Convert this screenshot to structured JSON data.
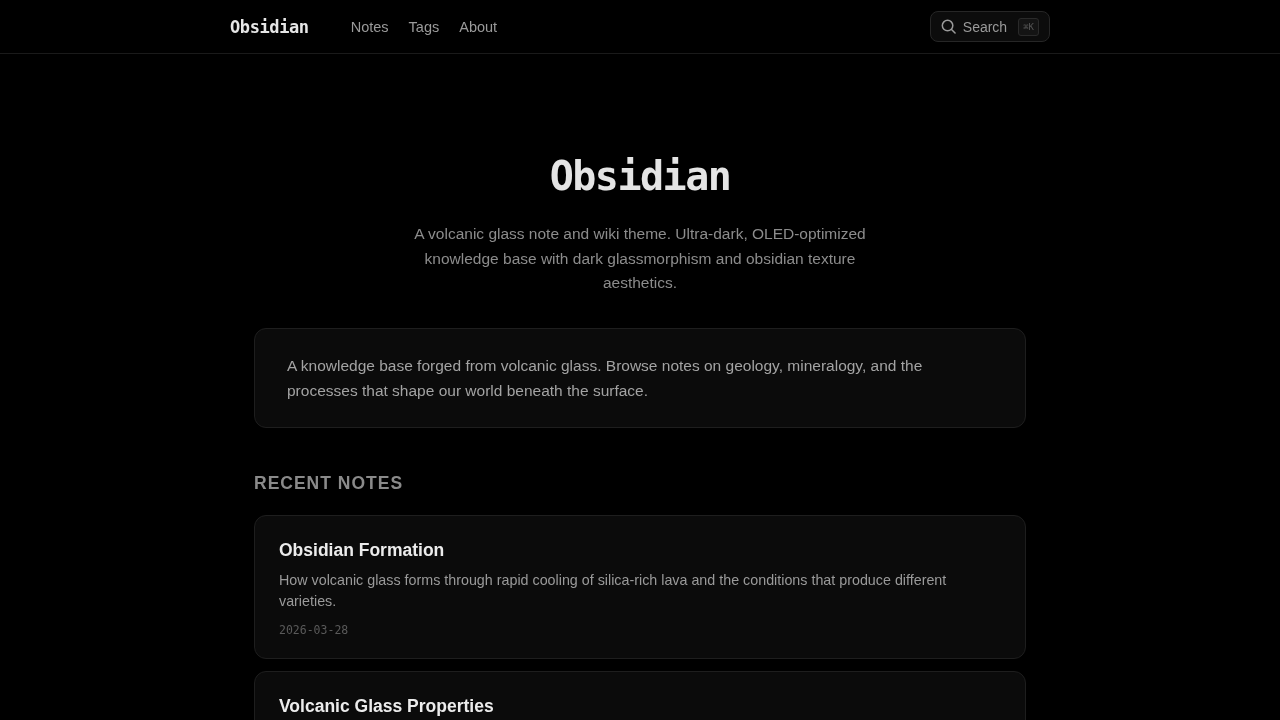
{
  "header": {
    "brand": "Obsidian",
    "nav": [
      {
        "label": "Notes"
      },
      {
        "label": "Tags"
      },
      {
        "label": "About"
      }
    ],
    "search": {
      "label": "Search",
      "shortcut": "⌘K"
    }
  },
  "hero": {
    "title": "Obsidian",
    "subtitle": "A volcanic glass note and wiki theme. Ultra-dark, OLED-optimized knowledge base with dark glassmorphism and obsidian texture aesthetics."
  },
  "intro": "A knowledge base forged from volcanic glass. Browse notes on geology, mineralogy, and the processes that shape our world beneath the surface.",
  "recent_notes": {
    "heading": "RECENT NOTES",
    "notes": [
      {
        "title": "Obsidian Formation",
        "description": "How volcanic glass forms through rapid cooling of silica-rich lava and the conditions that produce different varieties.",
        "date": "2026-03-28"
      },
      {
        "title": "Volcanic Glass Properties"
      }
    ]
  }
}
